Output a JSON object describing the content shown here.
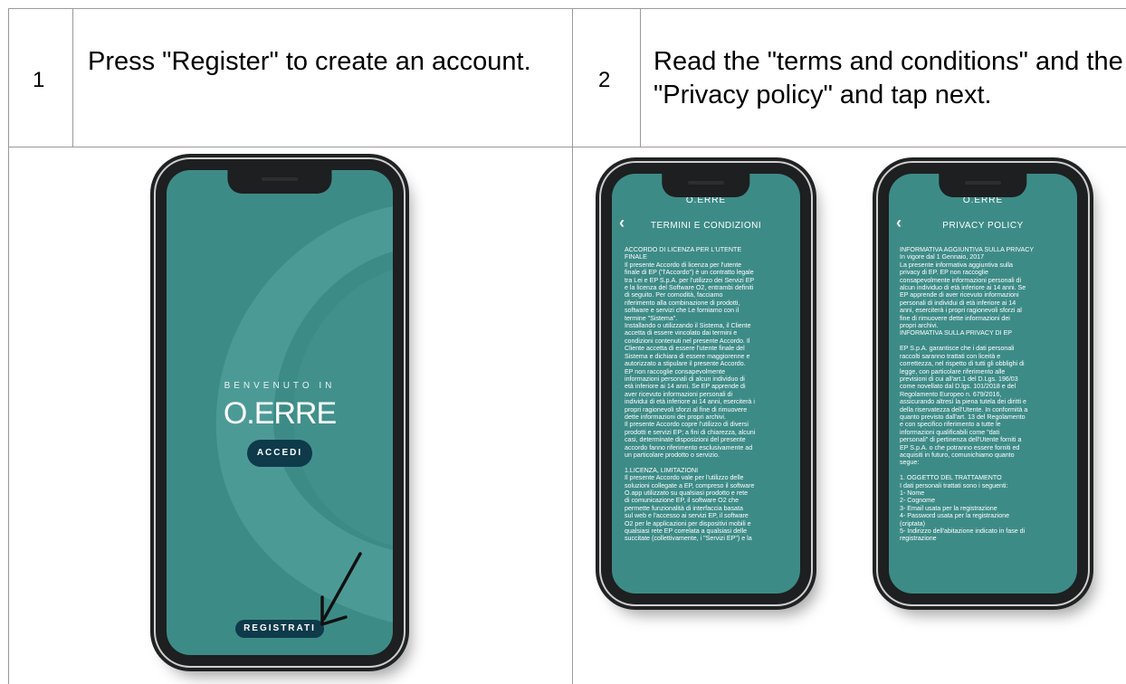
{
  "steps": [
    {
      "number": "1",
      "text": "Press \"Register\" to create an account."
    },
    {
      "number": "2",
      "text": "Read the \"terms and conditions\" and the \"Privacy policy\" and tap next."
    }
  ],
  "phone1": {
    "welcome": "BENVENUTO IN",
    "brand": "O.ERRE",
    "login_button": "ACCEDI",
    "register_button": "REGISTRATI"
  },
  "phone2": {
    "logo": "O.ERRE",
    "title": "TERMINI E CONDIZIONI",
    "body": "ACCORDO DI LICENZA PER L'UTENTE\nFINALE\nIl presente Accordo di licenza per l'utente\nfinale di EP (\"l'Accordo\") è un contratto legale\ntra Lei e EP S.p.A. per l'utilizzo dei Servizi EP\ne la licenza del Software O2, entrambi definiti\ndi seguito. Per comodità, facciamo\nriferimento alla combinazione di prodotti,\nsoftware e servizi che Le forniamo con il\ntermine \"Sistema\".\nInstallando o utilizzando il Sistema, il Cliente\naccetta di essere vincolato dai termini e\ncondizioni contenuti nel presente Accordo. Il\nCliente accetta di essere l'utente finale del\nSistema e dichiara di essere maggiorenne e\nautorizzato a stipulare il presente Accordo.\nEP non raccoglie consapevolmente\ninformazioni personali di alcun individuo di\netà inferiore ai 14 anni. Se EP apprende di\naver ricevuto informazioni personali di\nindividui di età inferiore ai 14 anni, eserciterà i\npropri ragionevoli sforzi al fine di rimuovere\ndette informazioni dei propri archivi.\nIl presente Accordo copre l'utilizzo di diversi\nprodotti e servizi EP; a fini di chiarezza, alcuni\ncasi, determinate disposizioni del presente\naccordo fanno riferimento esclusivamente ad\nun particolare prodotto o servizio.\n\n1.LICENZA, LIMITAZIONI\nIl presente Accordo vale per l'utilizzo delle\nsoluzioni collegate a EP, compreso il software\nO.app utilizzato su qualsiasi prodotto e rete\ndi comunicazione EP, il software O2 che\npermette funzionalità di interfaccia basata\nsul web e l'accesso ai servizi EP, il software\nO2 per le applicazioni per dispositivi mobili e\nqualsiasi rete EP correlata a qualsiasi delle\nsuccitate (collettivamente, i \"Servizi EP\") e la"
  },
  "phone3": {
    "logo": "O.ERRE",
    "title": "PRIVACY POLICY",
    "body": "INFORMATIVA AGGIUNTIVA SULLA PRIVACY\nIn vigore dal 1 Gennaio, 2017\nLa presente informativa aggiuntiva sulla\nprivacy di EP. EP non raccoglie\nconsapevolmente informazioni personali di\nalcun individuo di età inferiore ai 14 anni. Se\nEP apprende di aver ricevuto informazioni\npersonali di individui di età inferiore ai 14\nanni, eserciterà i propri ragionevoli sforzi al\nfine di rimuovere dette informazioni dei\npropri archivi.\nINFORMATIVA SULLA PRIVACY DI EP\n\nEP S.p.A. garantisce che i dati personali\nraccolti saranno trattati con liceità e\ncorrettezza, nel rispetto di tutti gli obblighi di\nlegge, con particolare riferimento alle\nprevisioni di cui all'art.1 del D.Lgs. 196/03\ncome novellato dal D.lgs. 101/2018 e del\nRegolamento Europeo n. 679/2016,\nassicurando altresì la piena tutela dei diritti e\ndella riservatezza dell'Utente. In conformità a\nquanto previsto dall'art. 13 del Regolamento\ne con specifico riferimento a tutte le\ninformazioni qualificabili come \"dati\npersonali\" di pertinenza dell'Utente forniti a\nEP S.p.A. o che potranno essere forniti ed\nacquisiti in futuro, comunichiamo quanto\nsegue:\n\n1. OGGETTO DEL TRATTAMENTO\nI dati personali trattati sono i seguenti:\n1- Nome\n2- Cognome\n3- Email usata per la registrazione\n4- Password usata per la registrazione\n(criptata)\n5- Indirizzo dell'abitazione indicato in fase di\nregistrazione"
  },
  "colors": {
    "screen": "#3d8b87",
    "button": "#0e3a4a",
    "border": "#9a9a9a"
  }
}
